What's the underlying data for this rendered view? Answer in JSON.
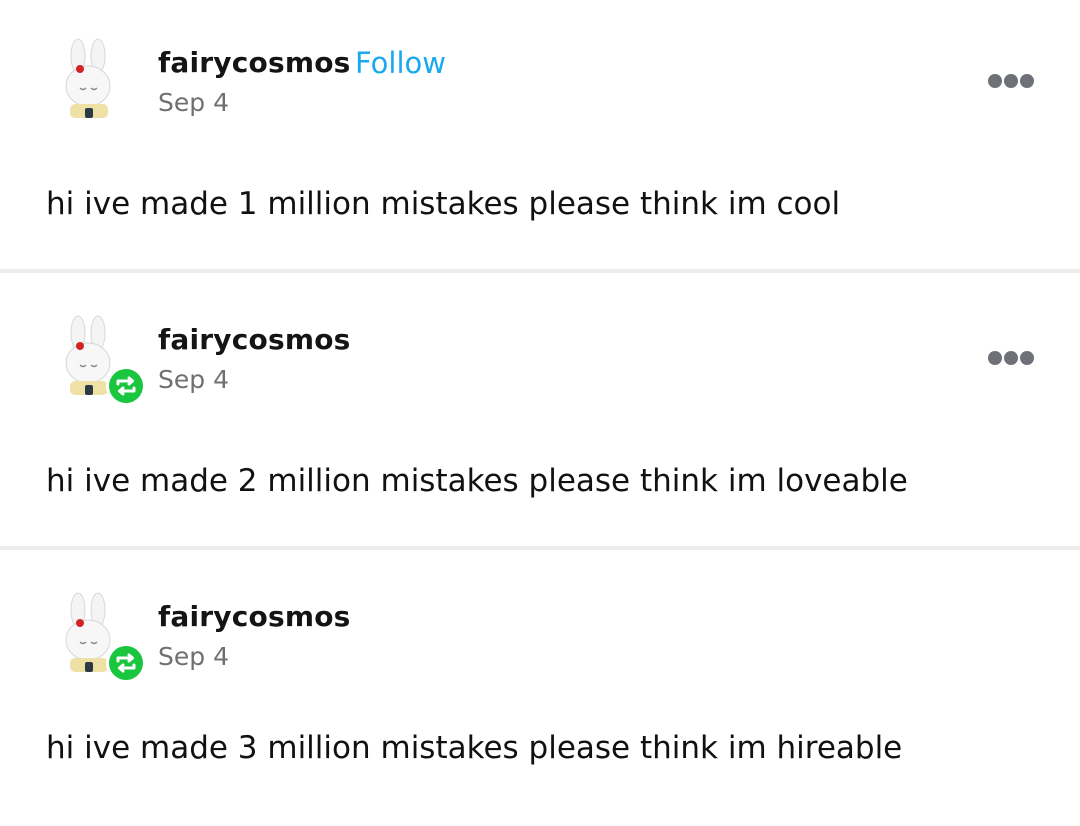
{
  "posts": [
    {
      "username": "fairycosmos",
      "follow_label": "Follow",
      "date": "Sep 4",
      "text": "hi ive made 1 million mistakes please think im cool",
      "reblogged": false
    },
    {
      "username": "fairycosmos",
      "date": "Sep 4",
      "text": "hi ive made 2 million mistakes please think im loveable",
      "reblogged": true
    },
    {
      "username": "fairycosmos",
      "date": "Sep 4",
      "text": "hi ive made 3 million mistakes please think im hireable",
      "reblogged": true
    }
  ],
  "icons": {
    "avatar": "white-bunny-avatar",
    "reblog": "reblog-icon",
    "more": "more-options-icon"
  },
  "colors": {
    "follow": "#1aa9ef",
    "reblog_badge": "#1bc63f",
    "muted_text": "#707070",
    "divider": "#ececec"
  }
}
